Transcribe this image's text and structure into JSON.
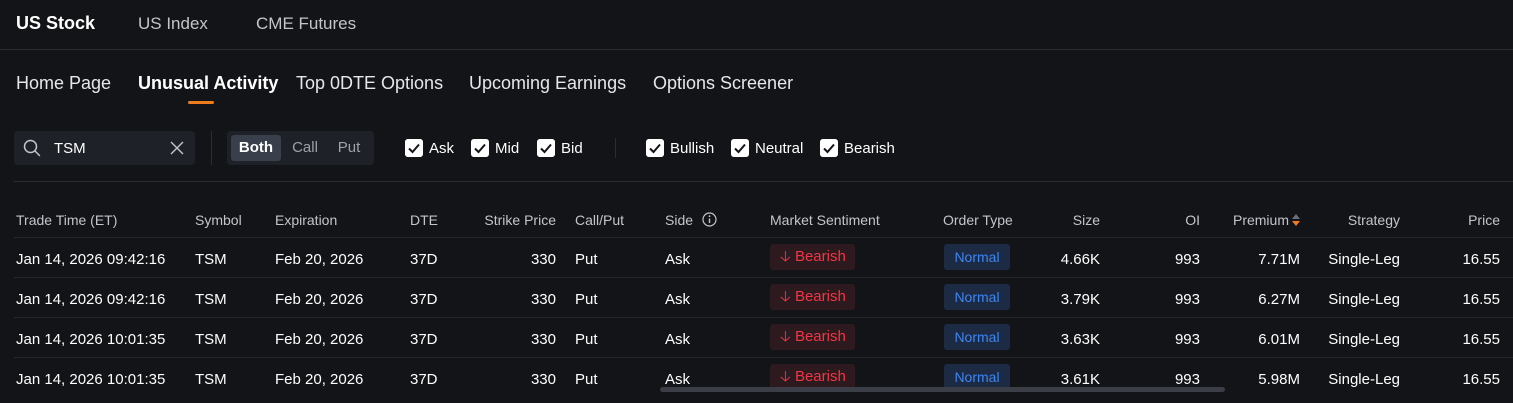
{
  "market_tabs": [
    "US Stock",
    "US Index",
    "CME Futures"
  ],
  "sub_tabs": [
    "Home Page",
    "Unusual Activity",
    "Top 0DTE Options",
    "Upcoming Earnings",
    "Options Screener"
  ],
  "search": {
    "value": "TSM",
    "icon": "search-icon",
    "clear_icon": "close-icon"
  },
  "option_type": {
    "options": [
      "Both",
      "Call",
      "Put"
    ],
    "selected": "Both"
  },
  "side_filters": [
    {
      "label": "Ask",
      "checked": true
    },
    {
      "label": "Mid",
      "checked": true
    },
    {
      "label": "Bid",
      "checked": true
    }
  ],
  "sentiment_filters": [
    {
      "label": "Bullish",
      "checked": true
    },
    {
      "label": "Neutral",
      "checked": true
    },
    {
      "label": "Bearish",
      "checked": true
    }
  ],
  "table": {
    "headers": {
      "trade_time": "Trade Time (ET)",
      "symbol": "Symbol",
      "expiration": "Expiration",
      "dte": "DTE",
      "strike": "Strike Price",
      "call_put": "Call/Put",
      "side": "Side",
      "sentiment": "Market Sentiment",
      "order_type": "Order Type",
      "size": "Size",
      "oi": "OI",
      "premium": "Premium",
      "strategy": "Strategy",
      "price": "Price"
    },
    "rows": [
      {
        "trade_time": "Jan 14, 2026 09:42:16",
        "symbol": "TSM",
        "expiration": "Feb 20, 2026",
        "dte": "37D",
        "strike": "330",
        "call_put": "Put",
        "side": "Ask",
        "sentiment": "Bearish",
        "order_type": "Normal",
        "size": "4.66K",
        "oi": "993",
        "premium": "7.71M",
        "strategy": "Single-Leg",
        "price": "16.55"
      },
      {
        "trade_time": "Jan 14, 2026 09:42:16",
        "symbol": "TSM",
        "expiration": "Feb 20, 2026",
        "dte": "37D",
        "strike": "330",
        "call_put": "Put",
        "side": "Ask",
        "sentiment": "Bearish",
        "order_type": "Normal",
        "size": "3.79K",
        "oi": "993",
        "premium": "6.27M",
        "strategy": "Single-Leg",
        "price": "16.55"
      },
      {
        "trade_time": "Jan 14, 2026 10:01:35",
        "symbol": "TSM",
        "expiration": "Feb 20, 2026",
        "dte": "37D",
        "strike": "330",
        "call_put": "Put",
        "side": "Ask",
        "sentiment": "Bearish",
        "order_type": "Normal",
        "size": "3.63K",
        "oi": "993",
        "premium": "6.01M",
        "strategy": "Single-Leg",
        "price": "16.55"
      },
      {
        "trade_time": "Jan 14, 2026 10:01:35",
        "symbol": "TSM",
        "expiration": "Feb 20, 2026",
        "dte": "37D",
        "strike": "330",
        "call_put": "Put",
        "side": "Ask",
        "sentiment": "Bearish",
        "order_type": "Normal",
        "size": "3.61K",
        "oi": "993",
        "premium": "5.98M",
        "strategy": "Single-Leg",
        "price": "16.55"
      }
    ]
  },
  "colors": {
    "background": "#131418",
    "accent": "#f07c1e",
    "bearish": "#f23645",
    "normal": "#3d86f5"
  }
}
